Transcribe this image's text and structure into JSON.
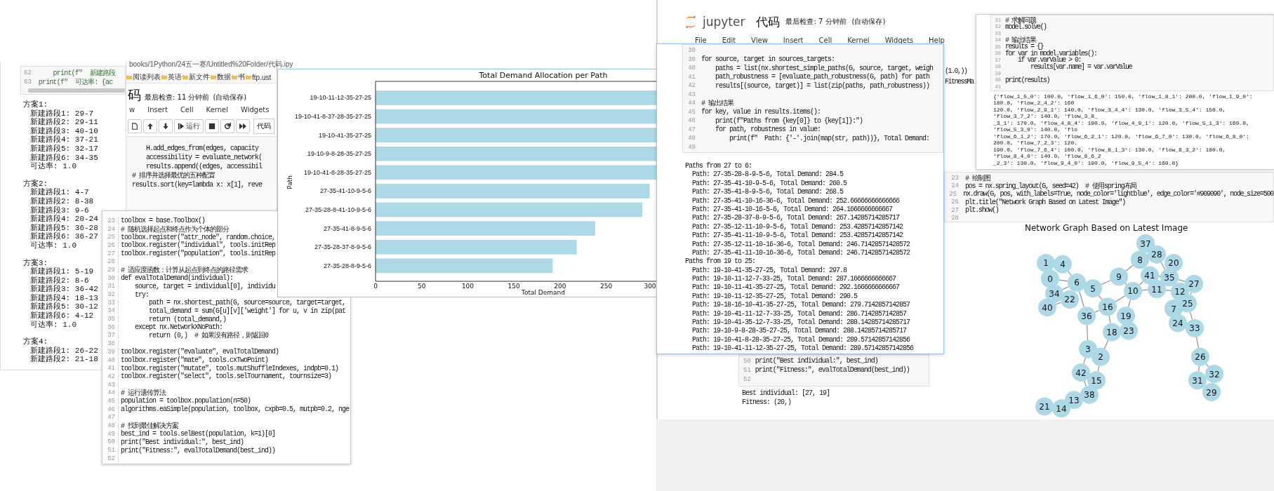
{
  "left_output": {
    "code_lines": [
      {
        "num": "62",
        "text": "    print(f\"  新建路段"
      },
      {
        "num": "63",
        "text": "print(f\"  可达率: {ac"
      }
    ],
    "plans": [
      {
        "title": "方案1:",
        "lines": [
          "新建路段1: 29-7",
          "新建路段2: 29-11",
          "新建路段3: 40-10",
          "新建路段4: 37-21",
          "新建路段5: 32-17",
          "新建路段6: 34-35",
          "可达率: 1.0"
        ]
      },
      {
        "title": "方案2:",
        "lines": [
          "新建路段1: 4-7",
          "新建路段2: 8-38",
          "新建路段3: 9-6",
          "新建路段4: 20-24",
          "新建路段5: 36-28",
          "新建路段6: 36-27",
          "可达率: 1.0"
        ]
      },
      {
        "title": "方案3:",
        "lines": [
          "新建路段1: 5-19",
          "新建路段2: 8-6",
          "新建路段3: 36-42",
          "新建路段4: 18-13",
          "新建路段5: 30-12",
          "新建路段6: 4-12",
          "可达率: 1.0"
        ]
      },
      {
        "title": "方案4:",
        "lines": [
          "新建路段1: 26-22",
          "新建路段2: 21-18"
        ]
      }
    ]
  },
  "notebook_window": {
    "url": "books/1Python/24五一赛/Untitled%20Folder/代码.ipy",
    "bookmarks": [
      "阅读列表",
      "英语",
      "新文件",
      "数据",
      "书",
      "ftp.ust"
    ],
    "title": "码",
    "status": "最后检查: 11 分钟前",
    "autosave": "(自动保存)",
    "menu": [
      "w",
      "Insert",
      "Cell",
      "Kernel",
      "Widgets"
    ],
    "run_label": "运行",
    "cell_type": "代码",
    "code_lines": [
      "    H.add_edges_from(edges, capacity",
      "    accessibility = evaluate_network(",
      "    results.append((edges, accessibil",
      "# 排序并选择最优的五种配置",
      "results.sort(key=lambda x: x[1], reve"
    ]
  },
  "code_window": {
    "lines": [
      {
        "num": "23",
        "text": "toolbox = base.Toolbox()"
      },
      {
        "num": "24",
        "text": "# 随机选择起点和终点作为个体的部分"
      },
      {
        "num": "25",
        "text": "toolbox.register(\"attr_node\", random.choice,"
      },
      {
        "num": "26",
        "text": "toolbox.register(\"individual\", tools.initRep"
      },
      {
        "num": "27",
        "text": "toolbox.register(\"population\", tools.initRep"
      },
      {
        "num": "28"
      },
      {
        "num": "29",
        "text": "# 适应度函数：计算从起点到终点的路径需求"
      },
      {
        "num": "30",
        "text": "def evalTotalDemand(individual):"
      },
      {
        "num": "31",
        "text": "    source, target = individual[0], individu"
      },
      {
        "num": "32",
        "text": "    try:"
      },
      {
        "num": "33",
        "text": "        path = nx.shortest_path(G, source=source, target=target,"
      },
      {
        "num": "34",
        "text": "        total_demand = sum(G[u][v]['weight'] for u, v in zip(pat"
      },
      {
        "num": "35",
        "text": "        return (total_demand,)"
      },
      {
        "num": "36",
        "text": "    except nx.NetworkXNoPath:"
      },
      {
        "num": "37",
        "text": "        return (0,)  # 如果没有路径，则返回0"
      },
      {
        "num": "38"
      },
      {
        "num": "39",
        "text": "toolbox.register(\"evaluate\", evalTotalDemand)"
      },
      {
        "num": "40",
        "text": "toolbox.register(\"mate\", tools.cxTwoPoint)"
      },
      {
        "num": "41",
        "text": "toolbox.register(\"mutate\", tools.mutShuffleIndexes, indpb=0.1)"
      },
      {
        "num": "42",
        "text": "toolbox.register(\"select\", tools.selTournament, tournsize=3)"
      },
      {
        "num": "43"
      },
      {
        "num": "44",
        "text": "# 运行遗传算法"
      },
      {
        "num": "45",
        "text": "population = toolbox.population(n=50)"
      },
      {
        "num": "46",
        "text": "algorithms.eaSimple(population, toolbox, cxpb=0.5, mutpb=0.2, nge"
      },
      {
        "num": "47"
      },
      {
        "num": "48",
        "text": "# 找到最佳解决方案"
      },
      {
        "num": "49",
        "text": "best_ind = tools.selBest(population, k=1)[0]"
      },
      {
        "num": "50",
        "text": "print(\"Best individual:\", best_ind)"
      },
      {
        "num": "51",
        "text": "print(\"Fitness:\", evalTotalDemand(best_ind))"
      },
      {
        "num": "52"
      }
    ]
  },
  "chart_window": {
    "chart_data": {
      "type": "bar",
      "orientation": "horizontal",
      "title": "Total Demand Allocation per Path",
      "xlabel": "Total Demand",
      "ylabel": "Path",
      "categories": [
        "19-10-11-12-35-27-25",
        "19-10-41-8-37-28-35-27-25",
        "19-10-41-35-27-25",
        "19-10-9-8-28-35-27-25",
        "19-10-41-8-28-35-27-25",
        "27-35-41-10-9-5-6",
        "27-35-28-8-41-10-9-5-6",
        "27-35-41-8-9-5-6",
        "27-35-28-37-8-9-5-6",
        "27-35-28-8-9-5-6"
      ],
      "values": [
        305,
        305,
        305,
        305,
        305,
        297,
        289,
        238,
        218,
        192
      ],
      "xlim": [
        0,
        305
      ],
      "xticks": [
        0,
        50,
        100,
        150,
        200,
        250,
        300
      ]
    }
  },
  "right_notebook": {
    "logo": "jupyter",
    "title": "代码",
    "status": "最后检查: 7 分钟前",
    "autosave": "(自动保存)",
    "menu": [
      "File",
      "Edit",
      "View",
      "Insert",
      "Cell",
      "Kernel",
      "Widgets",
      "Help"
    ],
    "side_text": [
      "(1.0,))",
      "FitnessMa"
    ],
    "draw_cell": [
      {
        "num": "23",
        "text": "# 绘制图"
      },
      {
        "num": "24",
        "text": "pos = nx.spring_layout(G, seed=42)  # 使用spring布局"
      },
      {
        "num": "25",
        "text": "nx.draw(G, pos, with_labels=True, node_color='lightblue', edge_color='#909090', node_size=500"
      },
      {
        "num": "26",
        "text": "plt.title(\"Network Graph Based on Latest Image\")"
      },
      {
        "num": "27",
        "text": "plt.show()"
      },
      {
        "num": "28"
      }
    ],
    "graph": {
      "title": "Network Graph Based on Latest Image",
      "nodes": [
        "1",
        "4",
        "0",
        "34",
        "22",
        "6",
        "40",
        "5",
        "36",
        "9",
        "16",
        "19",
        "10",
        "18",
        "23",
        "8",
        "37",
        "28",
        "41",
        "20",
        "35",
        "11",
        "12",
        "27",
        "25",
        "7",
        "24",
        "33",
        "26",
        "31",
        "32",
        "29",
        "3",
        "2",
        "42",
        "15",
        "38",
        "13",
        "21",
        "14"
      ]
    },
    "best_cell": {
      "lines": [
        {
          "num": "50",
          "text": "print(\"Best individual:\", best_ind)"
        },
        {
          "num": "51",
          "text": "print(\"Fitness:\", evalTotalDemand(best_ind))"
        },
        {
          "num": "52"
        }
      ],
      "output": [
        "Best individual: [27, 19]",
        "Fitness: (20,)"
      ]
    }
  },
  "results_popup": {
    "lines": [
      {
        "num": "38"
      },
      {
        "num": "39",
        "text": "for source, target in sources_targets:"
      },
      {
        "num": "40",
        "text": "    paths = list(nx.shortest_simple_paths(G, source, target, weigh"
      },
      {
        "num": "41",
        "text": "    path_robustness = [evaluate_path_robustness(G, path) for path"
      },
      {
        "num": "42",
        "text": "    results[(source, target)] = list(zip(paths, path_robustness))"
      },
      {
        "num": "43"
      },
      {
        "num": "44",
        "text": "# 输出结果"
      },
      {
        "num": "45",
        "text": "for key, value in results.items():"
      },
      {
        "num": "46",
        "text": "    print(f\"Paths from {key[0]} to {key[1]}:\")"
      },
      {
        "num": "47",
        "text": "    for path, robustness in value:"
      },
      {
        "num": "48",
        "text": "        print(f\"  Path: {'-'.join(map(str, path))}, Total Demand:"
      },
      {
        "num": "49"
      }
    ],
    "output": [
      "Paths from 27 to 6:",
      "  Path: 27-35-28-8-9-5-6, Total Demand: 284.5",
      "  Path: 27-35-41-10-9-5-6, Total Demand: 260.5",
      "  Path: 27-35-41-8-9-5-6, Total Demand: 268.5",
      "  Path: 27-35-41-10-16-36-6, Total Demand: 252.66666666666666",
      "  Path: 27-35-41-10-16-5-6, Total Demand: 264.1666666666667",
      "  Path: 27-35-28-37-8-9-5-6, Total Demand: 267.14285714285717",
      "  Path: 27-35-12-11-10-9-5-6, Total Demand: 253.42857142857142",
      "  Path: 27-35-41-11-10-9-5-6, Total Demand: 253.42857142857142",
      "  Path: 27-35-12-11-10-16-36-6, Total Demand: 246.71428571428572",
      "  Path: 27-35-41-11-10-16-36-6, Total Demand: 246.71428571428572",
      "Paths from 19 to 25:",
      "  Path: 19-10-41-35-27-25, Total Demand: 297.8",
      "  Path: 19-10-11-12-7-33-25, Total Demand: 287.1666666666667",
      "  Path: 19-10-11-41-35-27-25, Total Demand: 292.1666666666667",
      "  Path: 19-10-11-12-35-27-25, Total Demand: 290.5",
      "  Path: 19-18-16-10-41-35-27-25, Total Demand: 279.7142857142857",
      "  Path: 19-10-41-11-12-7-33-25, Total Demand: 286.7142857142857",
      "  Path: 19-10-41-35-12-7-33-25, Total Demand: 288.14285714285717",
      "  Path: 19-10-9-8-28-35-27-25, Total Demand: 288.14285714285717",
      "  Path: 19-10-41-8-28-35-27-25, Total Demand: 289.57142857142856",
      "  Path: 19-10-41-11-12-35-27-25, Total Demand: 289.57142857142856"
    ]
  },
  "solver_popup": {
    "lines": [
      {
        "num": "31",
        "text": "# 求解问题"
      },
      {
        "num": "32",
        "text": "model.solve()"
      },
      {
        "num": "33"
      },
      {
        "num": "34",
        "text": "# 输出结果"
      },
      {
        "num": "35",
        "text": "results = {}"
      },
      {
        "num": "36",
        "text": "for var in model.variables():"
      },
      {
        "num": "37",
        "text": "    if var.varValue > 0:"
      },
      {
        "num": "38",
        "text": "        results[var.name] = var.varValue"
      },
      {
        "num": "39"
      },
      {
        "num": "40",
        "text": "print(results)"
      },
      {
        "num": "41"
      }
    ],
    "output": [
      "{'flow_1_5_0': 100.0, 'flow_1_6_0': 150.0, 'flow_1_8_1': 200.0, 'flow_1_9_0': 180.0, 'flow_2_4_2': 160",
      "120.0, 'flow_2_9_1': 140.0, 'flow_3_4_4': 130.0, 'flow_3_5_4': 150.0, 'flow_3_7_2': 140.0, 'flow_3_8_",
      "_3_1': 170.0, 'flow_4_8_4': 190.0, 'flow_4_9_1': 120.0, 'flow_5_1_3': 160.0, 'flow_5_3_0': 140.0, 'flo",
      "'flow_6_1_2': 170.0, 'flow_6_2_1': 120.0, 'flow_6_7_0': 130.0, 'flow_6_8_0': 200.0, 'flow_7_2_3': 120.",
      "190.0, 'flow_7_6_4': 100.0, 'flow_8_1_3': 130.0, 'flow_8_3_2': 180.0, 'flow_8_4_0': 140.0, 'flow_8_6_2",
      "_2_3': 130.0, 'flow_9_4_0': 190.0, 'flow_9_5_4': 160.0}"
    ]
  }
}
